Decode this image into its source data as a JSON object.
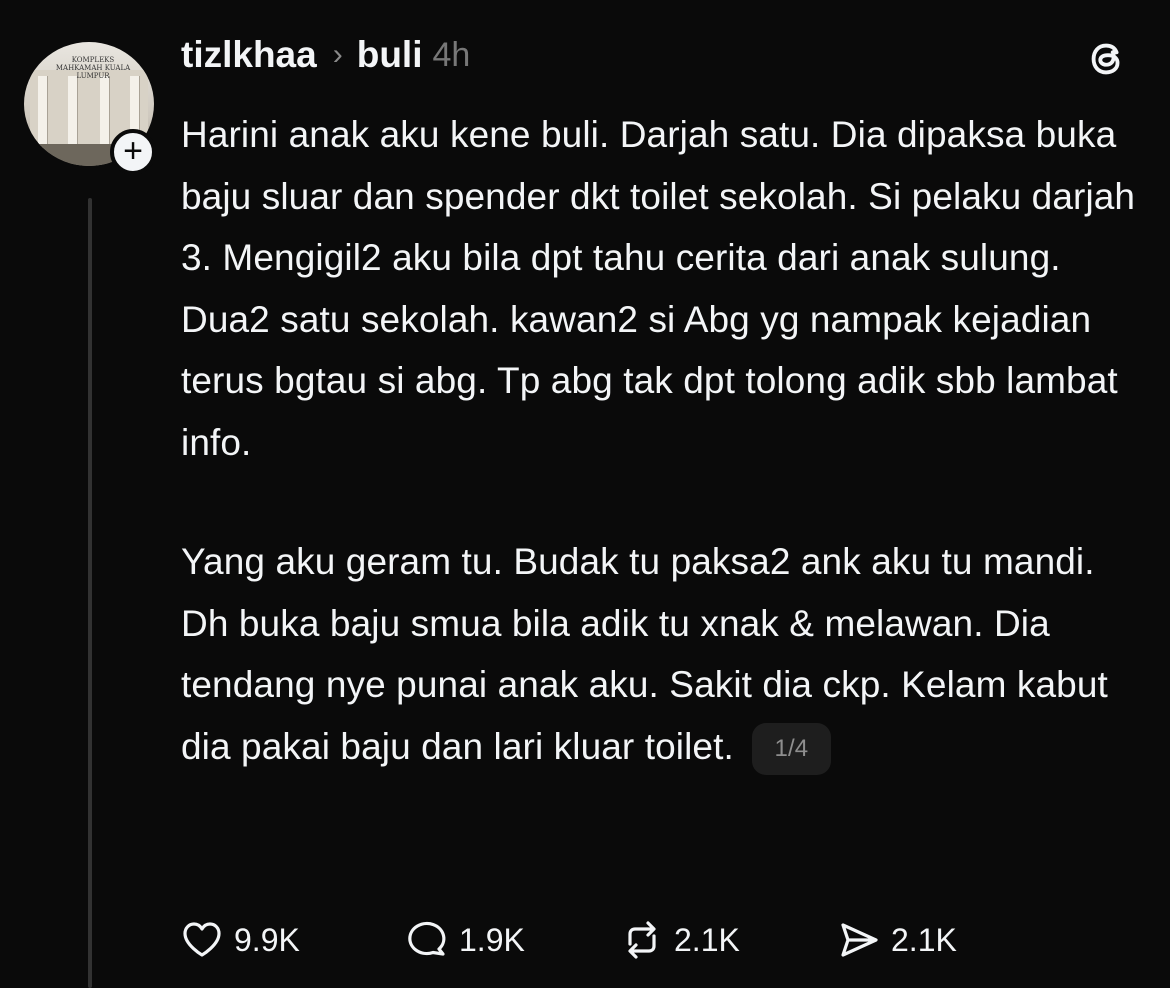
{
  "post": {
    "username": "tizlkhaa",
    "separator": "›",
    "topic": "buli",
    "time": "4h",
    "paragraphs": [
      "Harini anak aku kene buli. Darjah satu. Dia dipaksa buka baju sluar dan spender dkt toilet sekolah. Si pelaku darjah 3. Mengigil2 aku bila dpt tahu cerita dari anak sulung. Dua2 satu sekolah. kawan2 si Abg yg nampak kejadian terus bgtau si abg. Tp abg tak dpt tolong adik sbb lambat info.",
      "Yang aku geram tu. Budak tu paksa2 ank aku tu mandi. Dh buka baju smua bila adik tu xnak & melawan. Dia tendang nye punai anak aku. Sakit dia ckp. Kelam kabut dia pakai baju dan lari kluar toilet."
    ],
    "page_indicator": "1/4",
    "avatar_sign_text": "KOMPLEKS MAHKAMAH KUALA LUMPUR",
    "follow_symbol": "+"
  },
  "actions": {
    "likes": "9.9K",
    "replies": "1.9K",
    "reposts": "2.1K",
    "shares": "2.1K"
  },
  "icons": [
    "plus-icon",
    "threads-logo-icon",
    "heart-icon",
    "comment-icon",
    "repost-icon",
    "send-icon"
  ],
  "colors": {
    "background": "#0a0a0a",
    "text": "#f3f5f7",
    "muted": "#777777",
    "thread_line": "#323232",
    "badge_bg": "#1e1e1e"
  }
}
